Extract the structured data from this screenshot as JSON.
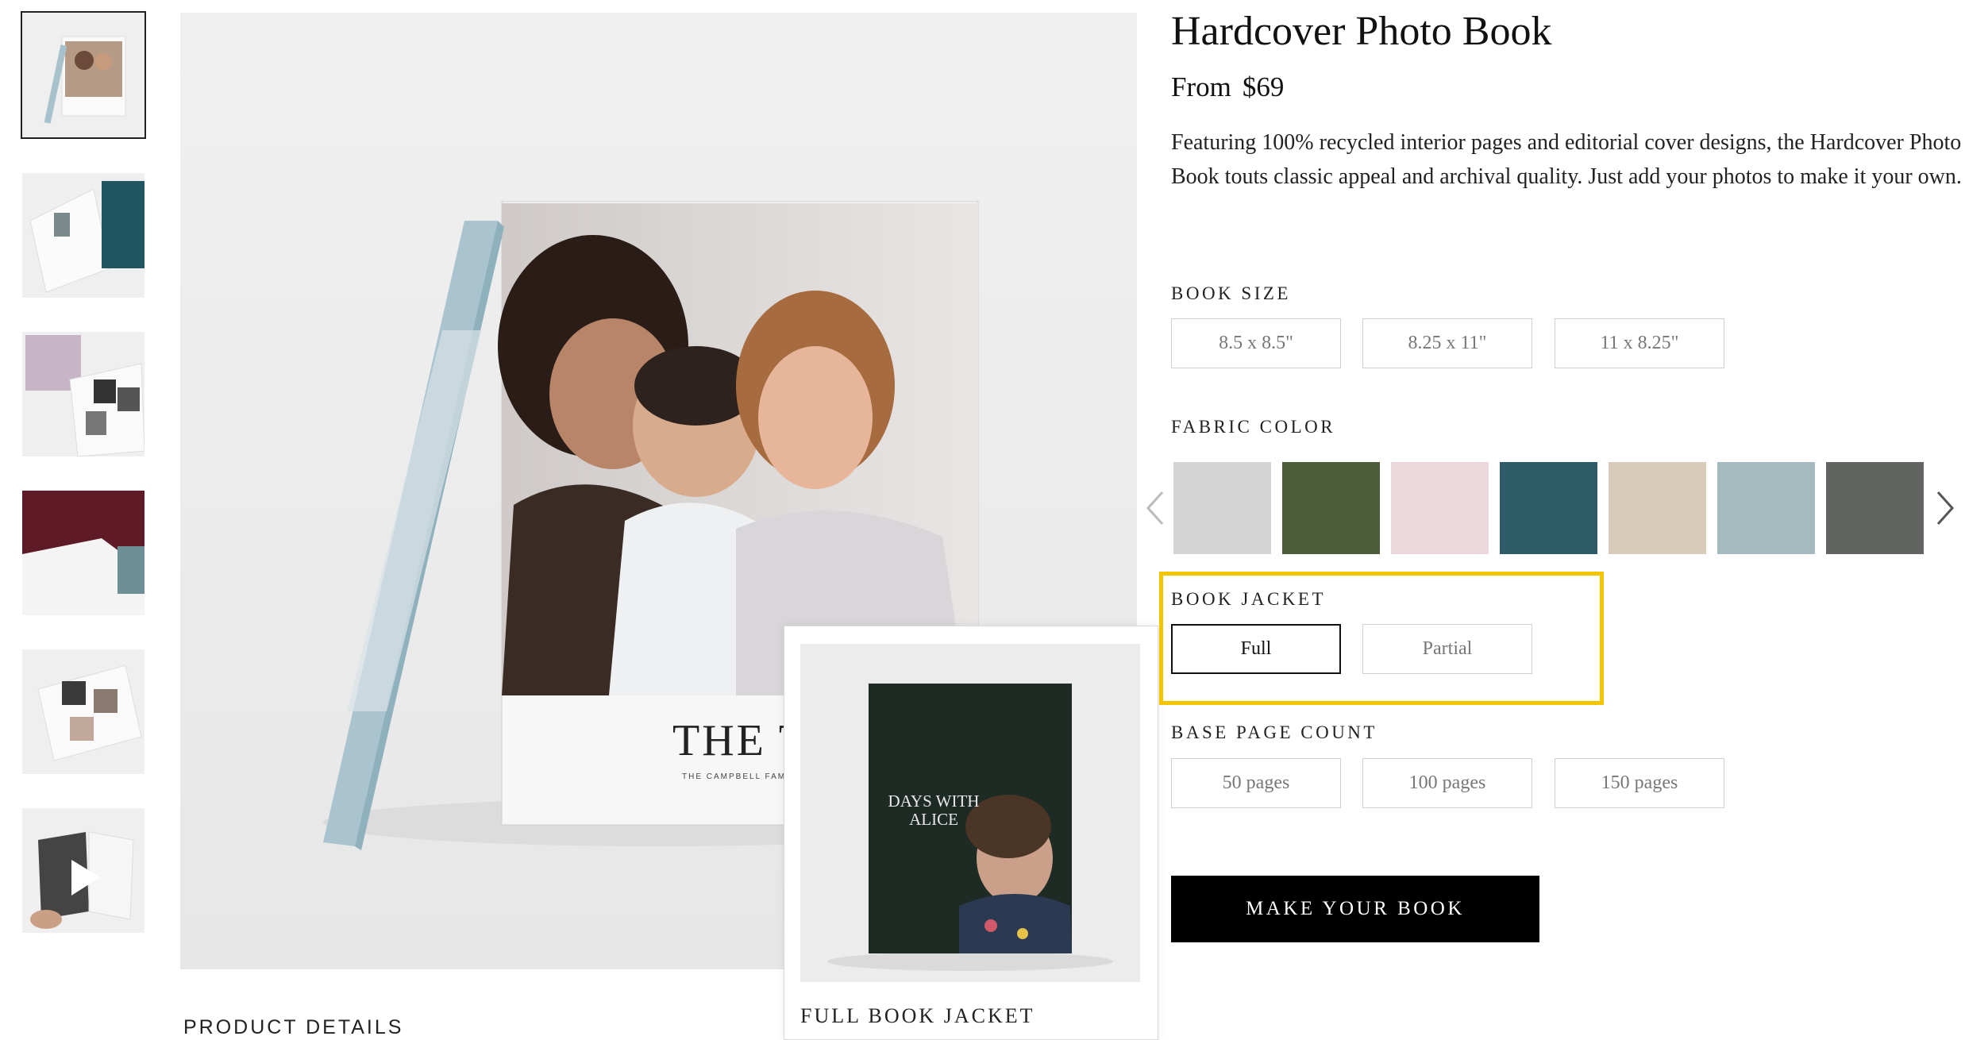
{
  "product": {
    "title": "Hardcover Photo Book",
    "price_prefix": "From",
    "price": "$69",
    "description": "Featuring 100% recycled interior pages and editorial cover designs, the Hardcover Photo Book touts classic appeal and archival quality. Just add your photos to make it your own."
  },
  "thumbnails": [
    {
      "icon": "book-cover-thumbnail",
      "selected": true
    },
    {
      "icon": "open-book-thumbnail"
    },
    {
      "icon": "book-spread-thumbnail"
    },
    {
      "icon": "floral-book-thumbnail"
    },
    {
      "icon": "photo-collage-thumbnail"
    },
    {
      "icon": "video-thumbnail"
    }
  ],
  "main_image": {
    "cover_title": "THE THREE",
    "cover_subtitle": "THE CAMPBELL FAMI"
  },
  "product_details_label": "PRODUCT DETAILS",
  "book_size": {
    "label": "BOOK SIZE",
    "options": [
      "8.5 x 8.5\"",
      "8.25 x 11\"",
      "11 x 8.25\""
    ]
  },
  "fabric_color": {
    "label": "FABRIC COLOR",
    "swatches": [
      "#d4d4d4",
      "#4d5d3a",
      "#ecd7da",
      "#2e5b68",
      "#d8cbba",
      "#a5babe",
      "#626462"
    ]
  },
  "book_jacket": {
    "label": "BOOK JACKET",
    "options": [
      "Full",
      "Partial"
    ],
    "selected": "Full"
  },
  "base_page_count": {
    "label": "BASE PAGE COUNT",
    "options": [
      "50 pages",
      "100 pages",
      "150 pages"
    ]
  },
  "cta": {
    "label": "MAKE YOUR BOOK"
  },
  "popup": {
    "label": "FULL BOOK JACKET",
    "book_title_line1": "DAYS WITH",
    "book_title_line2": "ALICE"
  },
  "colors": {
    "highlight": "#f5c400",
    "cta_bg": "#000000"
  }
}
